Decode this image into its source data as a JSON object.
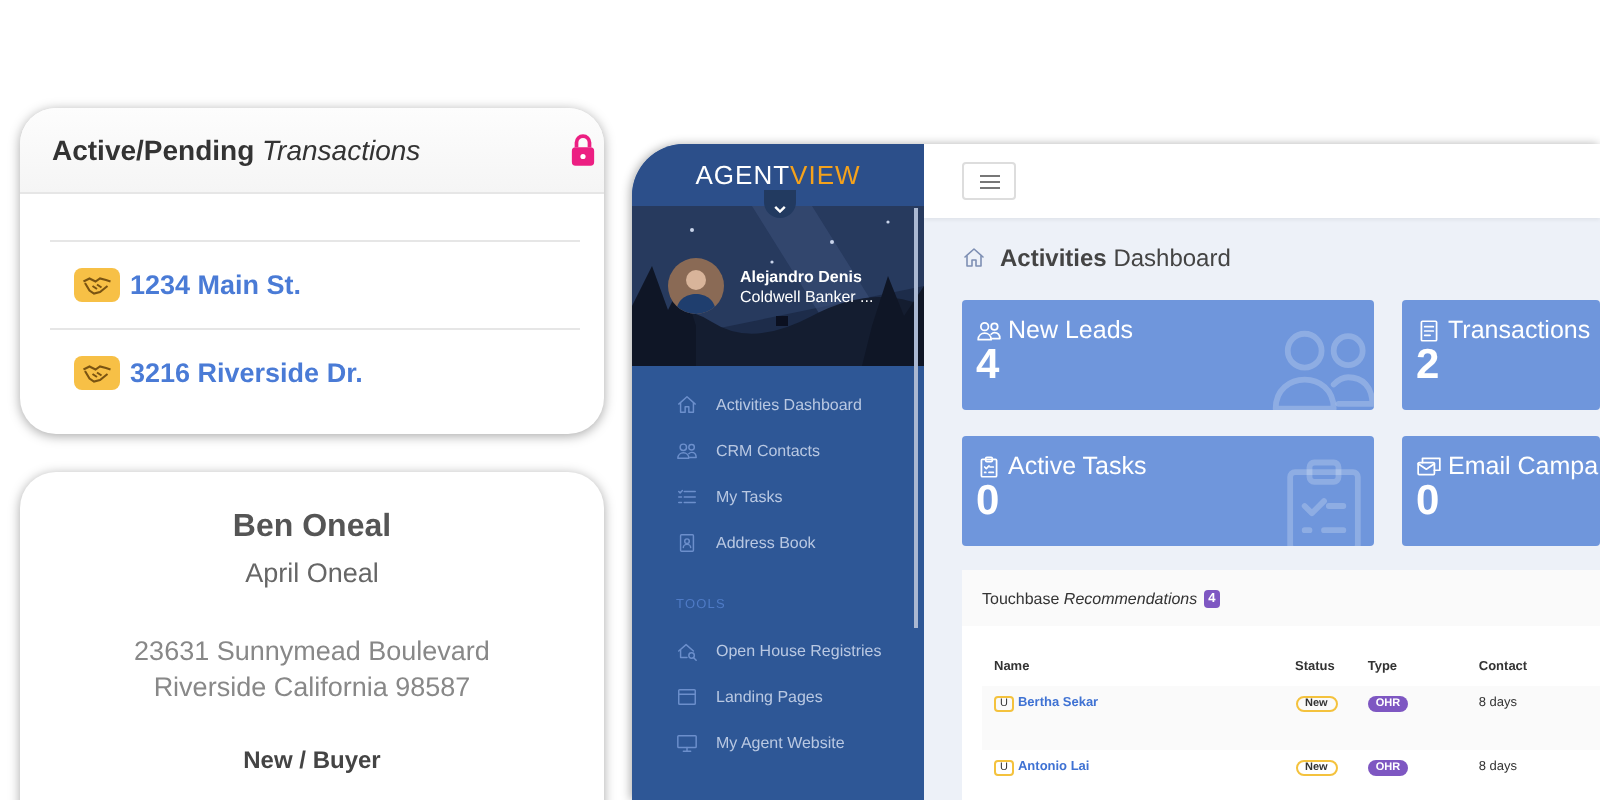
{
  "transactions_card": {
    "title": "**Active/Pending** *Transactions*",
    "locked": true,
    "items": [
      {
        "address": "1234 Main St."
      },
      {
        "address": "3216 Riverside Dr."
      }
    ]
  },
  "contact_card": {
    "name": "Ben Oneal",
    "spouse": "April Oneal",
    "address_lines": [
      "23631 Sunnymead Boulevard",
      "Riverside California 98587"
    ],
    "type": "New / Buyer"
  },
  "app": {
    "logo": [
      {
        "text": "AGENT",
        "accent": false
      },
      {
        "text": "VIEW",
        "accent": true
      }
    ],
    "profile": {
      "name": "Alejandro Denis",
      "company": "Coldwell Banker ..."
    },
    "nav": [
      {
        "label": "Activities Dashboard"
      },
      {
        "label": "CRM Contacts"
      },
      {
        "label": "My Tasks"
      },
      {
        "label": "Address Book"
      }
    ],
    "section_label": "TOOLS",
    "tools": [
      {
        "label": "Open House Registries"
      },
      {
        "label": "Landing Pages"
      },
      {
        "label": "My Agent Website"
      }
    ],
    "page_title": "**Activities** Dashboard",
    "stats": [
      {
        "label": "New Leads",
        "value": "4"
      },
      {
        "label": "Transactions",
        "value": "2"
      },
      {
        "label": "Active Tasks",
        "value": "0"
      },
      {
        "label": "Email Campa",
        "value": "0"
      }
    ],
    "touchbase": {
      "title": "Touchbase *Recommendations*",
      "count": "4",
      "columns": [
        "Name",
        "Status",
        "Type",
        "Contact"
      ],
      "rows": [
        {
          "initial": "U",
          "name": "Bertha Sekar",
          "status": "New",
          "type": "OHR",
          "contact": "8 days"
        },
        {
          "initial": "U",
          "name": "Antonio Lai",
          "status": "New",
          "type": "OHR",
          "contact": "8 days"
        }
      ]
    }
  }
}
